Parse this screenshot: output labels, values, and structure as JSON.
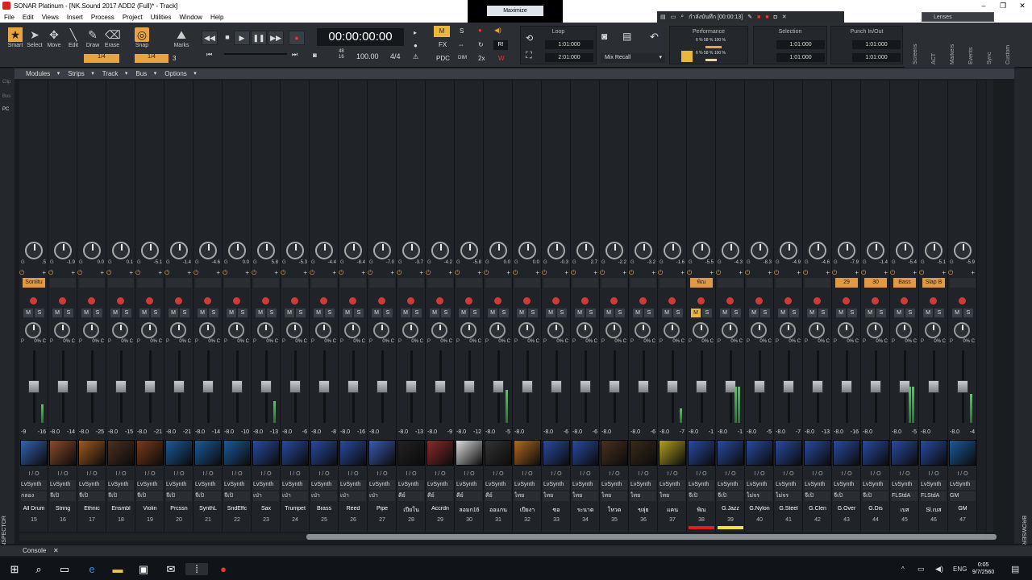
{
  "window": {
    "title": "SONAR Platinum - [NK.Sound 2017 ADD2 (Full)* - Track]"
  },
  "menu": [
    "File",
    "Edit",
    "Views",
    "Insert",
    "Process",
    "Project",
    "Utilities",
    "Window",
    "Help"
  ],
  "maximize_label": "Maximize",
  "floatbar": {
    "text": "กำลังบันทึก [00:00:13]"
  },
  "lenses_label": "Lenses",
  "tools": [
    {
      "label": "Smart",
      "icon": "star-icon"
    },
    {
      "label": "Select",
      "icon": "arrow-icon"
    },
    {
      "label": "Move",
      "icon": "move-icon"
    },
    {
      "label": "Edit",
      "icon": "edit-icon"
    },
    {
      "label": "Draw",
      "icon": "pencil-icon"
    },
    {
      "label": "Erase",
      "icon": "erase-icon"
    }
  ],
  "snap": {
    "label": "Snap",
    "value": "1/4",
    "left_value": "1/4",
    "marks_label": "Marks",
    "marks_value": "3"
  },
  "transport": {
    "time": "00:00:00:00",
    "tempo": "100.00",
    "meter": "4/4",
    "sig_top": "48",
    "sig_bottom": "16"
  },
  "mix_flags": {
    "m": "M",
    "s": "S",
    "fx": "FX",
    "pdc": "PDC",
    "dim": "DIM",
    "x2": "2x",
    "r": "R!",
    "w": "W"
  },
  "loop": {
    "title": "Loop",
    "start": "1:01:000",
    "end": "2:01:000"
  },
  "mix_recall": "Mix Recall",
  "performance": {
    "title": "Performance",
    "cpu": "6 %",
    "cpu2": "58 %",
    "cpu3": "100 %",
    "disk": "6 %",
    "disk2": "58 %",
    "disk3": "100 %"
  },
  "selection": {
    "title": "Selection",
    "start": "1:01:000",
    "end": "1:01:000"
  },
  "punch": {
    "title": "Punch In/Out",
    "start": "1:01:000",
    "end": "1:01:000"
  },
  "side_tabs": [
    "Screens",
    "ACT",
    "Markers",
    "Events",
    "Sync",
    "Custom"
  ],
  "strips_menu": [
    "Modules",
    "Strips",
    "Track",
    "Bus",
    "Options"
  ],
  "left_edge": {
    "labels": [
      "Clip",
      "Bus",
      "PC"
    ],
    "inspector": "INSPECTOR"
  },
  "browser_label": "BROWSER",
  "console_label": "Console",
  "io_label": "I / O",
  "gain_prefix": "G",
  "pan_prefix": "P",
  "pan_value": "0% C",
  "channels": [
    {
      "num": "15",
      "name": "All Drum",
      "gain": ".5",
      "vol": "-9",
      "peak": "-16",
      "fx": "Soniitu",
      "in": "LvSynth",
      "out": "กลอง",
      "photo": "#3463b0",
      "meter": 0.0,
      "meter_r": 0.25
    },
    {
      "num": "16",
      "name": "String",
      "gain": "-1.9",
      "vol": "-8.0",
      "peak": "-14",
      "fx": "",
      "in": "LvSynth",
      "out": "จีเปิ",
      "photo": "#8a4a2a",
      "meter": 0,
      "meter_r": 0
    },
    {
      "num": "17",
      "name": "Ethnic",
      "gain": "0.0",
      "vol": "-8.0",
      "peak": "-25",
      "fx": "",
      "in": "LvSynth",
      "out": "จีเปิ",
      "photo": "#a05a20",
      "meter": 0,
      "meter_r": 0
    },
    {
      "num": "18",
      "name": "Ensmbl",
      "gain": "0.1",
      "vol": "-8.0",
      "peak": "-15",
      "fx": "",
      "in": "LvSynth",
      "out": "จีเปิ",
      "photo": "#4a3020",
      "meter": 0,
      "meter_r": 0
    },
    {
      "num": "19",
      "name": "Violin",
      "gain": "-5.1",
      "vol": "-8.0",
      "peak": "-21",
      "fx": "",
      "in": "LvSynth",
      "out": "จีเปิ",
      "photo": "#7a3a1a",
      "meter": 0,
      "meter_r": 0
    },
    {
      "num": "20",
      "name": "Prcssn",
      "gain": "-1.4",
      "vol": "-8.0",
      "peak": "-21",
      "fx": "",
      "in": "LvSynth",
      "out": "จีเปิ",
      "photo": "#1a5a9a",
      "meter": 0,
      "meter_r": 0
    },
    {
      "num": "21",
      "name": "SynthL",
      "gain": "-4.6",
      "vol": "-8.0",
      "peak": "-14",
      "fx": "",
      "in": "LvSynth",
      "out": "จีเปิ",
      "photo": "#1a5a9a",
      "meter": 0,
      "meter_r": 0
    },
    {
      "num": "22",
      "name": "SndEffc",
      "gain": "0.0",
      "vol": "-8.0",
      "peak": "-10",
      "fx": "",
      "in": "LvSynth",
      "out": "จีเปิ",
      "photo": "#1a5a9a",
      "meter": 0,
      "meter_r": 0
    },
    {
      "num": "23",
      "name": "Sax",
      "gain": "5.8",
      "vol": "-8.0",
      "peak": "-13",
      "fx": "",
      "in": "LvSynth",
      "out": "เป่า",
      "photo": "#2a4aa0",
      "meter": 0,
      "meter_r": 0.3
    },
    {
      "num": "24",
      "name": "Trumpet",
      "gain": "-5.3",
      "vol": "-8.0",
      "peak": "-6",
      "fx": "",
      "in": "LvSynth",
      "out": "เป่า",
      "photo": "#2a4aa0",
      "meter": 0,
      "meter_r": 0
    },
    {
      "num": "25",
      "name": "Brass",
      "gain": "-4.4",
      "vol": "-8.0",
      "peak": "-8",
      "fx": "",
      "in": "LvSynth",
      "out": "เป่า",
      "photo": "#2a4aa0",
      "meter": 0,
      "meter_r": 0
    },
    {
      "num": "26",
      "name": "Reed",
      "gain": "-8.4",
      "vol": "-8.0",
      "peak": "-16",
      "fx": "",
      "in": "LvSynth",
      "out": "เป่า",
      "photo": "#2a4aa0",
      "meter": 0,
      "meter_r": 0
    },
    {
      "num": "27",
      "name": "Pipe",
      "gain": "-7.0",
      "vol": "-8.0",
      "peak": "",
      "fx": "",
      "in": "LvSynth",
      "out": "เป่า",
      "photo": "#3a5ab0",
      "meter": 0,
      "meter_r": 0
    },
    {
      "num": "28",
      "name": "เปียโน",
      "gain": "-3.7",
      "vol": "-8.0",
      "peak": "-13",
      "fx": "",
      "in": "LvSynth",
      "out": "คีย์",
      "photo": "#222222",
      "meter": 0,
      "meter_r": 0
    },
    {
      "num": "29",
      "name": "Accrdn",
      "gain": "-4.2",
      "vol": "-8.0",
      "peak": "-9",
      "fx": "",
      "in": "LvSynth",
      "out": "คีย์",
      "photo": "#8a2a2a",
      "meter": 0,
      "meter_r": 0
    },
    {
      "num": "30",
      "name": "ลอมก16",
      "gain": "-5.8",
      "vol": "-8.0",
      "peak": "-12",
      "fx": "",
      "in": "LvSynth",
      "out": "คีย์",
      "photo": "#dddddd",
      "meter": 0,
      "meter_r": 0
    },
    {
      "num": "31",
      "name": "ออแกน",
      "gain": "0.0",
      "vol": "-8.0",
      "peak": "-5",
      "fx": "",
      "in": "LvSynth",
      "out": "คีย์",
      "photo": "#333333",
      "meter": 0,
      "meter_r": 0.45
    },
    {
      "num": "32",
      "name": "เปียงา",
      "gain": "0.0",
      "vol": "-8.0",
      "peak": "",
      "fx": "",
      "in": "LvSynth",
      "out": "ไทย",
      "photo": "#b06a20",
      "meter": 0,
      "meter_r": 0
    },
    {
      "num": "33",
      "name": "ซอ",
      "gain": "-0.3",
      "vol": "-8.0",
      "peak": "-6",
      "fx": "",
      "in": "LvSynth",
      "out": "ไทย",
      "photo": "#2a4aa0",
      "meter": 0,
      "meter_r": 0
    },
    {
      "num": "34",
      "name": "ระนาด",
      "gain": "2.7",
      "vol": "-8.0",
      "peak": "-6",
      "fx": "",
      "in": "LvSynth",
      "out": "ไทย",
      "photo": "#2a4aa0",
      "meter": 0,
      "meter_r": 0
    },
    {
      "num": "35",
      "name": "โหวด",
      "gain": "-2.2",
      "vol": "-8.0",
      "peak": "",
      "fx": "",
      "in": "LvSynth",
      "out": "ไทย",
      "photo": "#4a3020",
      "meter": 0,
      "meter_r": 0
    },
    {
      "num": "36",
      "name": "ขลุ่ย",
      "gain": "-3.2",
      "vol": "-8.0",
      "peak": "-6",
      "fx": "",
      "in": "LvSynth",
      "out": "ไทย",
      "photo": "#3a2a1a",
      "meter": 0,
      "meter_r": 0
    },
    {
      "num": "37",
      "name": "แคน",
      "gain": "-1.6",
      "vol": "-8.0",
      "peak": "-7",
      "fx": "",
      "in": "LvSynth",
      "out": "ไทย",
      "photo": "#b0a020",
      "meter": 0,
      "meter_r": 0.2
    },
    {
      "num": "38",
      "name": "พิณ",
      "gain": "-5.5",
      "vol": "-8.0",
      "peak": "-1",
      "fx": "พิณ",
      "in": "LvSynth",
      "out": "จีเปิ",
      "photo": "#2a4aa0",
      "meter": 0,
      "meter_r": 0,
      "mute": true,
      "bar": "#e02020"
    },
    {
      "num": "39",
      "name": "G.Jazz",
      "gain": "-4.3",
      "vol": "-8.0",
      "peak": "-1",
      "fx": "",
      "in": "LvSynth",
      "out": "จีเปิ",
      "photo": "#2a4aa0",
      "meter": 0.5,
      "meter_r": 0.5,
      "bar": "#f0e040"
    },
    {
      "num": "40",
      "name": "G.Nylon",
      "gain": "-8.3",
      "vol": "-8.0",
      "peak": "-5",
      "fx": "",
      "in": "LvSynth",
      "out": "ไม่จร",
      "photo": "#2a4aa0",
      "meter": 0,
      "meter_r": 0
    },
    {
      "num": "41",
      "name": "G.Steel",
      "gain": "-4.9",
      "vol": "-8.0",
      "peak": "-7",
      "fx": "",
      "in": "LvSynth",
      "out": "ไม่จร",
      "photo": "#2a4aa0",
      "meter": 0,
      "meter_r": 0
    },
    {
      "num": "42",
      "name": "G.Clen",
      "gain": "-4.6",
      "vol": "-8.0",
      "peak": "-13",
      "fx": "",
      "in": "LvSynth",
      "out": "จีเปิ",
      "photo": "#2a4aa0",
      "meter": 0,
      "meter_r": 0
    },
    {
      "num": "43",
      "name": "G.Over",
      "gain": "-7.9",
      "vol": "-8.0",
      "peak": "-16",
      "fx": "29",
      "in": "LvSynth",
      "out": "จีเปิ",
      "photo": "#2a4aa0",
      "meter": 0,
      "meter_r": 0
    },
    {
      "num": "44",
      "name": "G.Dis",
      "gain": "-1.4",
      "vol": "-8.0",
      "peak": "",
      "fx": "30",
      "in": "LvSynth",
      "out": "จีเปิ",
      "photo": "#2a4aa0",
      "meter": 0,
      "meter_r": 0
    },
    {
      "num": "45",
      "name": "เบส",
      "gain": "-5.4",
      "vol": "-8.0",
      "peak": "-5",
      "fx": "Bass",
      "in": "LvSynth",
      "out": "FLStdA",
      "photo": "#2a4aa0",
      "meter": 0.5,
      "meter_r": 0.5
    },
    {
      "num": "46",
      "name": "Sl.เบส",
      "gain": "-5.1",
      "vol": "-8.0",
      "peak": "",
      "fx": "Slap B",
      "in": "LvSynth",
      "out": "FLStdA",
      "photo": "#2a4aa0",
      "meter": 0,
      "meter_r": 0
    },
    {
      "num": "47",
      "name": "GM",
      "gain": "-5.9",
      "vol": "-8.0",
      "peak": "-4",
      "fx": "",
      "in": "LvSynth",
      "out": "GM",
      "photo": "#1a5a9a",
      "meter": 0,
      "meter_r": 0.4
    }
  ],
  "clock": {
    "time": "0:05",
    "date": "9/7/2560",
    "lang": "ENG"
  }
}
